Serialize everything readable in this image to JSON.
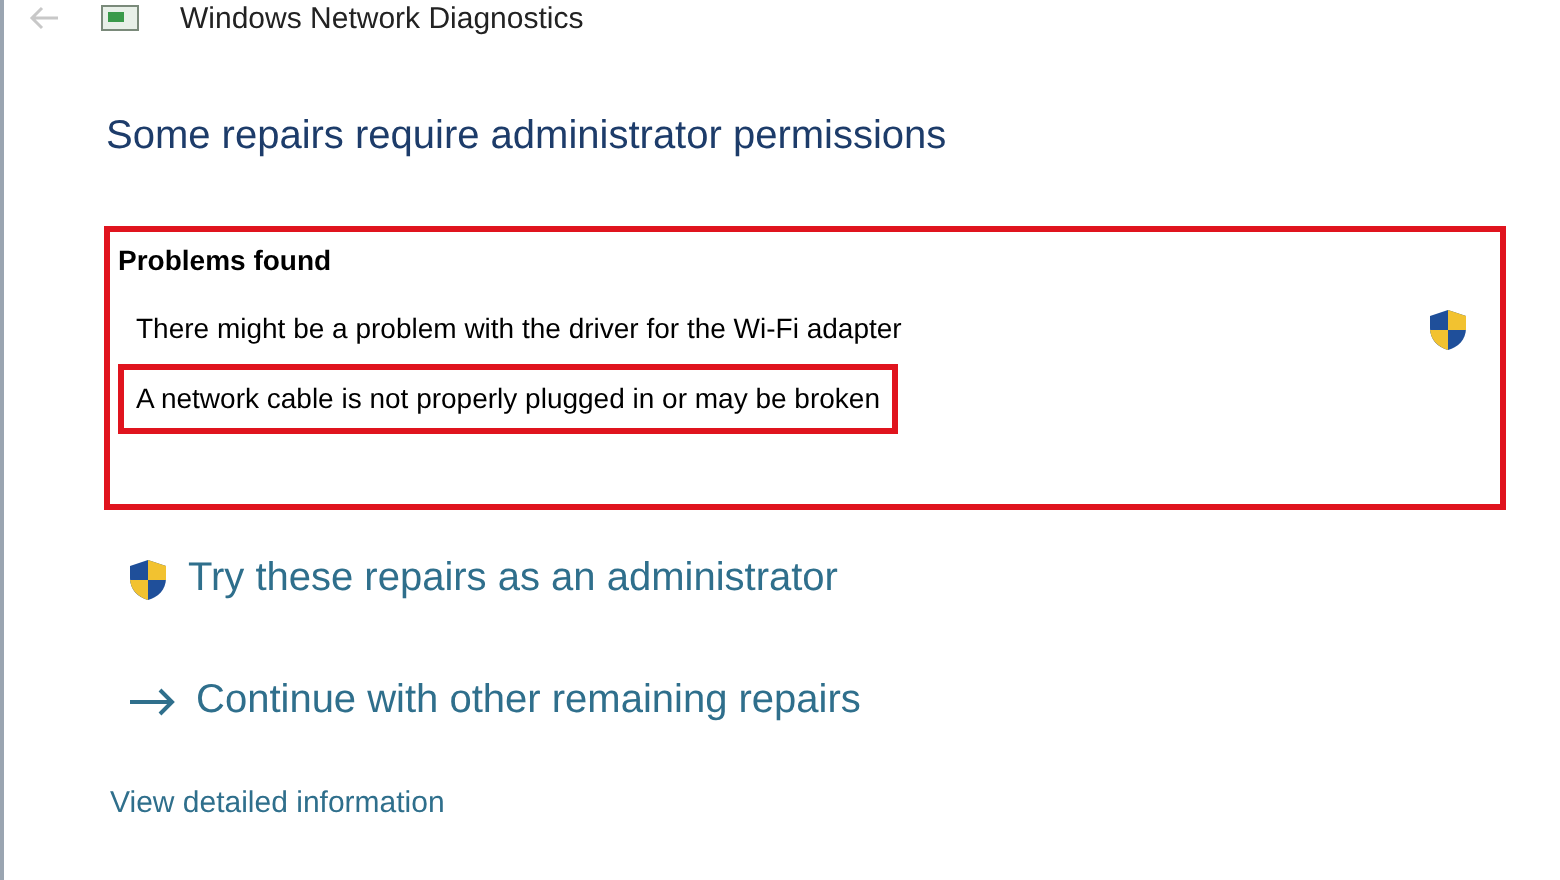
{
  "window": {
    "title": "Windows Network Diagnostics"
  },
  "heading": "Some repairs require administrator permissions",
  "problems": {
    "title": "Problems found",
    "highlighted": true,
    "items": [
      {
        "text": "There might be a problem with the driver for the Wi-Fi adapter",
        "highlighted": false
      },
      {
        "text": "A network cable is not properly plugged in or may be broken",
        "highlighted": true
      }
    ]
  },
  "actions": [
    {
      "kind": "admin",
      "label": "Try these repairs as an administrator"
    },
    {
      "kind": "continue",
      "label": "Continue with other remaining repairs"
    }
  ],
  "details_link": "View detailed information"
}
